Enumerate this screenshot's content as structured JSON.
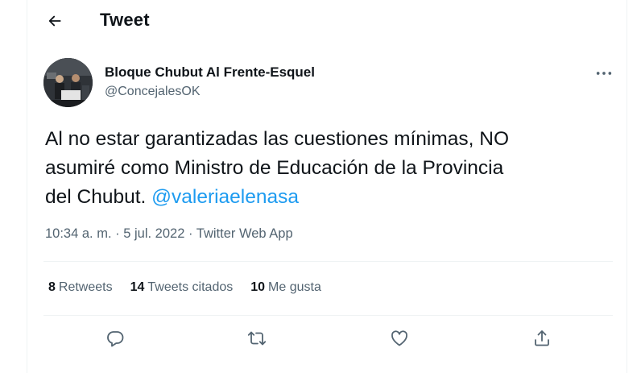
{
  "header": {
    "title": "Tweet"
  },
  "tweet": {
    "author_name": "Bloque Chubut Al Frente-Esquel",
    "author_handle": "@ConcejalesOK",
    "text_line1": "Al no estar garantizadas las cuestiones mínimas, NO",
    "text_line2": "asumiré como Ministro de Educación de la Provincia",
    "text_line3_prefix": "del Chubut. ",
    "mention": "@valeriaelenasa",
    "time": "10:34 a. m.",
    "separator": "·",
    "date": "5 jul. 2022",
    "source": "Twitter Web App"
  },
  "stats": {
    "retweets_count": "8",
    "retweets_label": "Retweets",
    "quotes_count": "14",
    "quotes_label": "Tweets citados",
    "likes_count": "10",
    "likes_label": "Me gusta"
  },
  "icons": {
    "back": "arrow-left-icon",
    "more": "more-icon",
    "reply": "reply-icon",
    "retweet": "retweet-icon",
    "like": "heart-icon",
    "share": "share-icon"
  },
  "colors": {
    "accent": "#1d9bf0",
    "text": "#0f1419",
    "secondary": "#536471",
    "border": "#eff3f4"
  }
}
